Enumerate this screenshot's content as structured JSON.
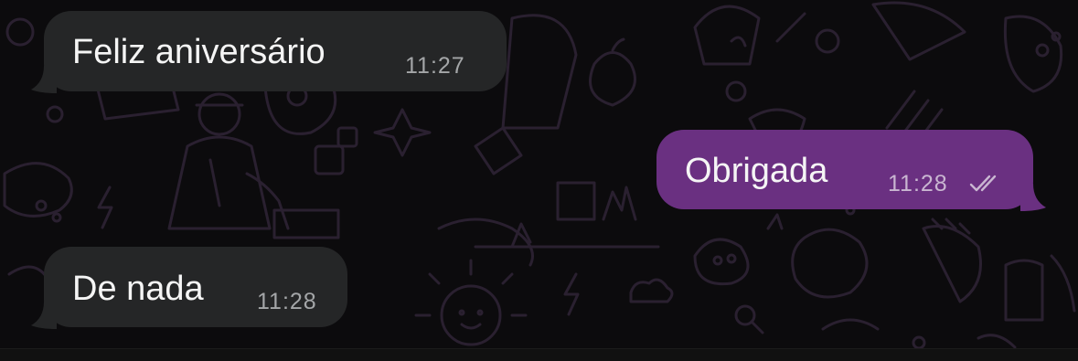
{
  "colors": {
    "background": "#0c0b0d",
    "incoming_bubble": "#252627",
    "outgoing_bubble": "#6a3081",
    "wallpaper_lines": "#2a2030"
  },
  "messages": [
    {
      "direction": "incoming",
      "text": "Feliz aniversário",
      "time": "11:27"
    },
    {
      "direction": "outgoing",
      "text": "Obrigada",
      "time": "11:28",
      "status_icon": "double-check-icon"
    },
    {
      "direction": "incoming",
      "text": "De nada",
      "time": "11:28"
    }
  ]
}
